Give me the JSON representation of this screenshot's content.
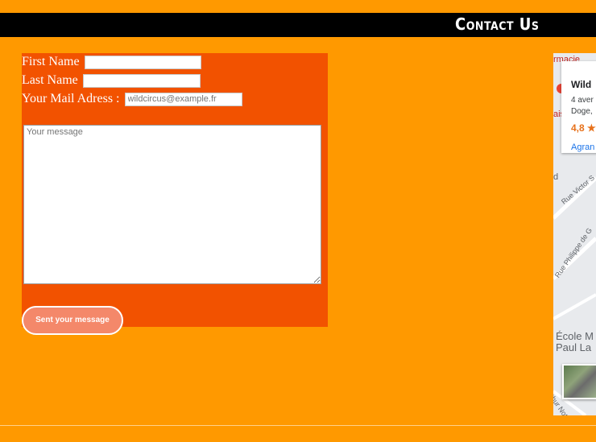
{
  "header": {
    "title": "Contact Us"
  },
  "form": {
    "first_name_label": "First Name",
    "last_name_label": "Last Name",
    "mail_label": "Your Mail Adress :",
    "mail_placeholder": "wildcircus@example.fr",
    "message_placeholder": "Your message",
    "send_label": "Sent your message"
  },
  "map": {
    "place_name": "Wild",
    "address_line1": "4 aver",
    "address_line2": "Doge,",
    "rating": "4,8 ★",
    "link": "Agran",
    "street_1": "Rue Victor S",
    "street_2": "Rue Philippe de G",
    "school_line1": "École M",
    "school_line2": "Paul La",
    "street_3": "rthur Noteb",
    "top_fragment_1": "rmacie",
    "top_fragment_2": "ais",
    "side_letter": "d"
  },
  "colors": {
    "background": "#ff9900",
    "panel": "#f25200",
    "header": "#000000",
    "button": "#f4886a"
  }
}
